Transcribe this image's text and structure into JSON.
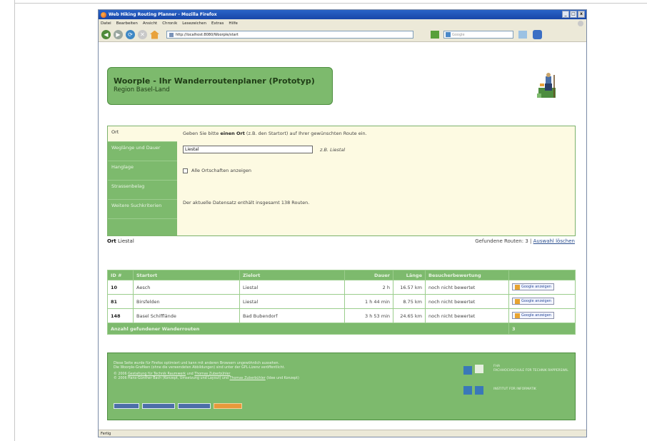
{
  "window": {
    "title": "Web Hiking Routing Planner - Mozilla Firefox",
    "buttons": {
      "minimize": "_",
      "maximize": "□",
      "close": "x"
    }
  },
  "menu": [
    "Datei",
    "Bearbeiten",
    "Ansicht",
    "Chronik",
    "Lesezeichen",
    "Extras",
    "Hilfe"
  ],
  "toolbar": {
    "url": "http://localhost:8080/Woorple/start",
    "search_placeholder": "Google"
  },
  "header": {
    "title": "Woorple - Ihr Wanderroutenplaner (Prototyp)",
    "subtitle": "Region Basel-Land"
  },
  "sidebar": {
    "items": [
      {
        "label": "Ort"
      },
      {
        "label": "Weglänge und Dauer"
      },
      {
        "label": "Hanglage"
      },
      {
        "label": "Strassenbelag"
      },
      {
        "label": "Weitere Suchkriterien"
      }
    ]
  },
  "form": {
    "instruction_pre": "Geben Sie bitte ",
    "instruction_bold": "einen Ort",
    "instruction_post": " (z.B. den Startort) auf Ihrer gewünschten Route ein.",
    "ort_value": "Liestal",
    "example": "z.B. Liestal",
    "checkbox_label": "Alle Ortschaften anzeigen",
    "info": "Der aktuelle Datensatz enthält insgesamt 138 Routen."
  },
  "summary": {
    "ort_label": "Ort",
    "ort_value": "Liestal",
    "found_text": "Gefundene Routen: 3 |",
    "clear_link": "Auswahl löschen"
  },
  "table": {
    "headers": [
      "ID #",
      "Startort",
      "Zielort",
      "Dauer",
      "Länge",
      "Besucherbewertung",
      ""
    ],
    "rows": [
      {
        "id": "10",
        "start": "Aesch",
        "ziel": "Liestal",
        "dauer": "2 h",
        "laenge": "16.57 km",
        "bewertung": "noch nicht bewertet",
        "map": "Google anzeigen"
      },
      {
        "id": "81",
        "start": "Birsfelden",
        "ziel": "Liestal",
        "dauer": "1 h 44 min",
        "laenge": "8.75 km",
        "bewertung": "noch nicht bewertet",
        "map": "Google anzeigen"
      },
      {
        "id": "148",
        "start": "Basel Schifflände",
        "ziel": "Bad Bubendorf",
        "dauer": "3 h 53 min",
        "laenge": "24.65 km",
        "bewertung": "noch nicht bewertet",
        "map": "Google anzeigen"
      }
    ],
    "footer_label": "Anzahl gefundener Wanderrouten",
    "footer_count": "3"
  },
  "footer": {
    "line1": "Diese Seite wurde für Firefox optimiert und kann mit anderen Browsern ungewöhnlich aussehen.",
    "line2": "Die Woorple-Grafiken (ohne die verwendeten Abbildungen) sind unter der GPL-Lizenz veröffentlicht.",
    "line3_pre": "© 2006 ",
    "line3_a": "Gestaltung für Technik Raumwerk",
    "line3_mid": " und ",
    "line3_b": "Thomas Zuberbühler",
    "line4_pre": "© 2006 Hans-Günther Bach (Konzept, Umsetzung und Layout) und ",
    "line4_a": "Thomas Zuberbühler",
    "line4_post": " (Idee und Konzept)",
    "right_label_1": "FHA",
    "right_label_2": "FACHHOCHSCHULE FÜR TECHNIK RAPPERSWIL",
    "right_label_3": "INSTITUT FÜR INFORMATIK"
  },
  "status": "Fertig",
  "colors": {
    "accent_green": "#7dba6d",
    "panel_cream": "#fdfae2",
    "titlebar_blue": "#2a64c8"
  }
}
